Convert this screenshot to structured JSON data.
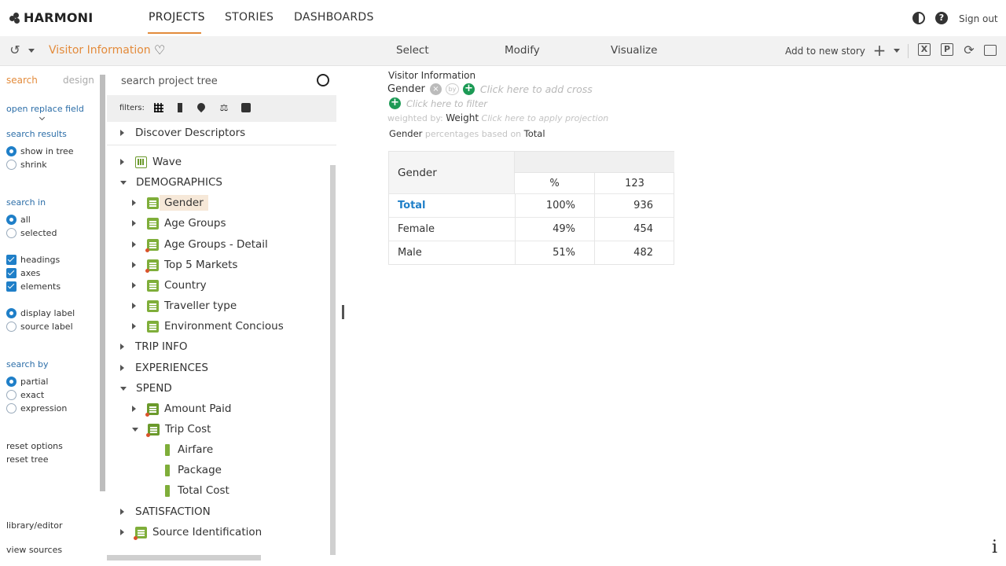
{
  "app": {
    "brand": "HARMONI"
  },
  "nav": {
    "tabs": [
      {
        "label": "PROJECTS",
        "active": true
      },
      {
        "label": "STORIES",
        "active": false
      },
      {
        "label": "DASHBOARDS",
        "active": false
      }
    ],
    "sign_out": "Sign out"
  },
  "toolbar": {
    "project_title": "Visitor Information",
    "modes": [
      "Select",
      "Modify",
      "Visualize"
    ],
    "add_to_story": "Add to new story"
  },
  "options": {
    "tabs": [
      "search",
      "design"
    ],
    "open_replace": "open replace field",
    "search_results": {
      "heading": "search results",
      "items": [
        "show in tree",
        "shrink"
      ],
      "selected": 0
    },
    "search_in": {
      "heading": "search in",
      "items": [
        "all",
        "selected"
      ],
      "selected": 0
    },
    "checks": [
      "headings",
      "axes",
      "elements"
    ],
    "label_mode": {
      "items": [
        "display label",
        "source label"
      ],
      "selected": 0
    },
    "search_by": {
      "heading": "search by",
      "items": [
        "partial",
        "exact",
        "expression"
      ],
      "selected": 0
    },
    "reset_options": "reset options",
    "reset_tree": "reset tree",
    "library_editor": "library/editor",
    "view_sources": "view sources"
  },
  "tree": {
    "search_placeholder": "search project tree",
    "filters_label": "filters:",
    "discover": "Discover Descriptors",
    "rows": [
      {
        "label": "Wave",
        "level": 0,
        "caret": "right",
        "icon": "grid"
      },
      {
        "label": "DEMOGRAPHICS",
        "level": 0,
        "caret": "down",
        "icon": "none"
      },
      {
        "label": "Gender",
        "level": 1,
        "caret": "right",
        "icon": "var",
        "selected": true
      },
      {
        "label": "Age Groups",
        "level": 1,
        "caret": "right",
        "icon": "var"
      },
      {
        "label": "Age Groups - Detail",
        "level": 1,
        "caret": "right",
        "icon": "var-red"
      },
      {
        "label": "Top 5 Markets",
        "level": 1,
        "caret": "right",
        "icon": "var-red"
      },
      {
        "label": "Country",
        "level": 1,
        "caret": "right",
        "icon": "var"
      },
      {
        "label": "Traveller type",
        "level": 1,
        "caret": "right",
        "icon": "var"
      },
      {
        "label": "Environment Concious",
        "level": 1,
        "caret": "right",
        "icon": "var"
      },
      {
        "label": "TRIP INFO",
        "level": 0,
        "caret": "right",
        "icon": "none"
      },
      {
        "label": "EXPERIENCES",
        "level": 0,
        "caret": "right",
        "icon": "none"
      },
      {
        "label": "SPEND",
        "level": 0,
        "caret": "down",
        "icon": "none"
      },
      {
        "label": "Amount Paid",
        "level": 1,
        "caret": "right",
        "icon": "multi"
      },
      {
        "label": "Trip Cost",
        "level": 1,
        "caret": "down",
        "icon": "multi"
      },
      {
        "label": "Airfare",
        "level": 2,
        "caret": "none",
        "icon": "leaf"
      },
      {
        "label": "Package",
        "level": 2,
        "caret": "none",
        "icon": "leaf"
      },
      {
        "label": "Total Cost",
        "level": 2,
        "caret": "none",
        "icon": "leaf"
      },
      {
        "label": "SATISFACTION",
        "level": 0,
        "caret": "right",
        "icon": "none"
      },
      {
        "label": "Source Identification",
        "level": 0,
        "caret": "right",
        "icon": "var-red"
      }
    ]
  },
  "table_spec": {
    "breadcrumb": "Visitor Information",
    "row_axis": "Gender",
    "by_text": "by",
    "add_cross_hint": "Click here to add cross",
    "filter_hint": "Click here to filter",
    "weighted_by_label": "weighted by:",
    "weight": "Weight",
    "projection_hint": "Click here to apply projection",
    "pct_axis": "Gender",
    "pct_based_on_label": "percentages based on",
    "pct_base": "Total"
  },
  "xtab": {
    "corner": "Gender",
    "columns": [
      "%",
      "123"
    ],
    "rows": [
      {
        "label": "Total",
        "pct": "100%",
        "count": "936",
        "is_total": true
      },
      {
        "label": "Female",
        "pct": "49%",
        "count": "454",
        "is_total": false
      },
      {
        "label": "Male",
        "pct": "51%",
        "count": "482",
        "is_total": false
      }
    ]
  },
  "colors": {
    "accent": "#e38b3b",
    "link": "#1f7fc8",
    "tree_icon": "#7fae3a",
    "add_green": "#1c9a55"
  },
  "icons": {
    "top_right": [
      "contrast-icon",
      "help-icon"
    ],
    "toolbar": [
      "history-icon",
      "heart-icon",
      "plus-icon",
      "excel-icon",
      "powerpoint-icon",
      "refresh-icon",
      "present-icon"
    ],
    "filters": [
      "grid-filter-icon",
      "list-filter-icon",
      "location-filter-icon",
      "scale-filter-icon",
      "folder-filter-icon"
    ]
  }
}
